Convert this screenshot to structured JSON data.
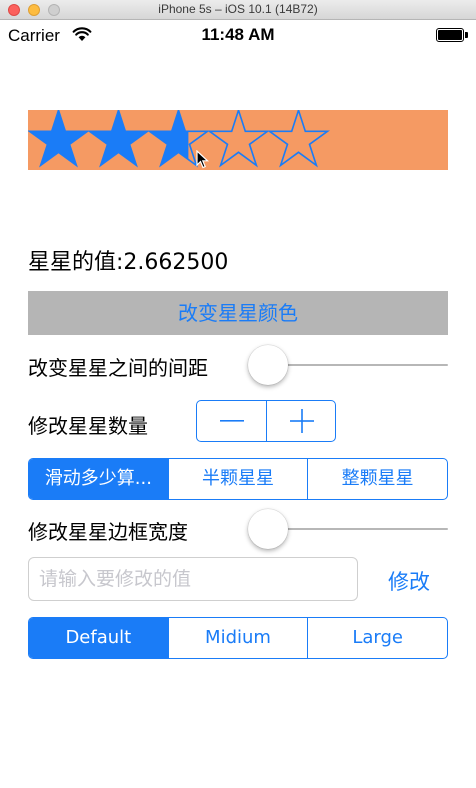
{
  "window": {
    "title": "iPhone 5s – iOS 10.1 (14B72)"
  },
  "status_bar": {
    "carrier": "Carrier",
    "time": "11:48 AM"
  },
  "rating": {
    "max_stars": 5,
    "value": 2.6625,
    "background_color": "#f59a63",
    "star_color": "#1a7cf7"
  },
  "value_text": "星星的值:2.662500",
  "change_color_button": "改变星星颜色",
  "spacing_label": "改变星星之间的间距",
  "spacing_slider_value": 0,
  "count_label": "修改星星数量",
  "stepper": {
    "minus_icon": "minus-icon",
    "plus_icon": "plus-icon"
  },
  "mode_segments": [
    {
      "label": "滑动多少算...",
      "selected": true
    },
    {
      "label": "半颗星星",
      "selected": false
    },
    {
      "label": "整颗星星",
      "selected": false
    }
  ],
  "border_width_label": "修改星星边框宽度",
  "border_slider_value": 0,
  "input": {
    "placeholder": "请输入要修改的值",
    "value": ""
  },
  "modify_button": "修改",
  "size_segments": [
    {
      "label": "Default",
      "selected": true
    },
    {
      "label": "Midium",
      "selected": false
    },
    {
      "label": "Large",
      "selected": false
    }
  ],
  "colors": {
    "accent": "#1a7cf7",
    "button_gray": "#b5b5b5"
  }
}
